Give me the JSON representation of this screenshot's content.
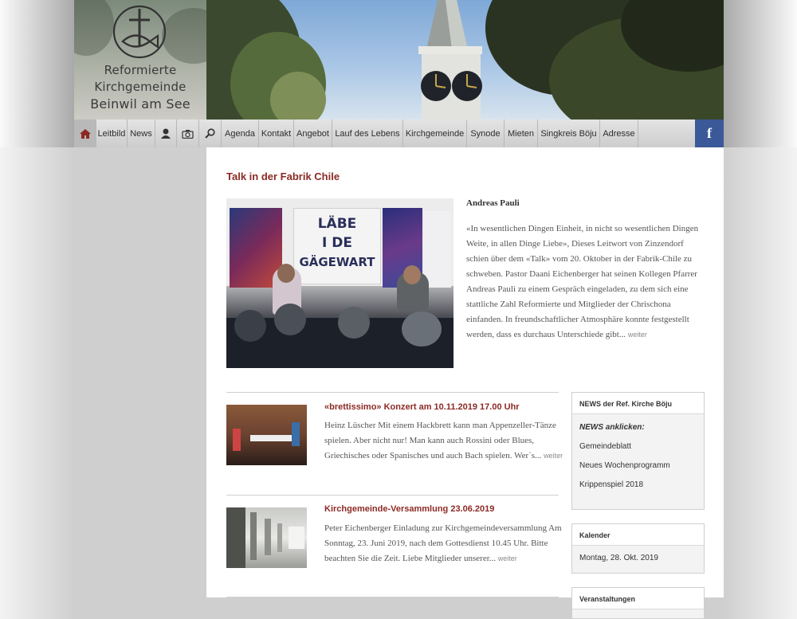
{
  "logo": {
    "lines": [
      "Reformierte",
      "Kirchgemeinde",
      "Beinwil am See"
    ]
  },
  "nav": {
    "home_icon": "home-icon",
    "items": [
      "Leitbild",
      "News",
      "Agenda",
      "Kontakt",
      "Angebot",
      "Lauf des Lebens",
      "Kirchgemeinde",
      "Synode",
      "Mieten",
      "Singkreis Böju",
      "Adresse"
    ],
    "person_icon": "person-icon",
    "camera_icon": "camera-icon",
    "search_icon": "search-icon",
    "facebook_label": "f"
  },
  "featured": {
    "title": "Talk in der Fabrik Chile",
    "image_text": [
      "LÄBE",
      "I DE",
      "GÄGEWART"
    ],
    "author": "Andreas Pauli",
    "text": "«In wesentlichen Dingen Einheit, in nicht so wesentlichen Dingen Weite, in allen Dinge Liebe», Dieses Leitwort von Zinzendorf schien über dem «Talk» vom 20. Oktober in der Fabrik-Chile zu schweben. Pastor Daani Eichenberger hat seinen Kollegen Pfarrer Andreas Pauli zu einem Gespräch eingeladen, zu dem sich eine stattliche Zahl Reformierte und Mitglieder der Chrischona einfanden. In freundschaftlicher Atmosphäre konnte festgestellt werden, dass es durchaus Unterschiede gibt...",
    "more": "weiter"
  },
  "articles": [
    {
      "title": "«brettissimo» Konzert am 10.11.2019 17.00 Uhr",
      "text": "Heinz Lüscher Mit einem Hackbrett kann man Appenzeller-Tänze spielen. Aber nicht nur! Man kann auch Rossini oder Blues, Griechisches oder Spanisches und auch Bach spielen. Wer`s...",
      "more": "weiter"
    },
    {
      "title": "Kirchgemeinde-Versammlung 23.06.2019",
      "text": "Peter Eichenberger Einladung zur Kirchgemeindeversammlung Am Sonntag, 23. Juni 2019, nach dem Gottesdienst 10.45 Uhr. Bitte beachten Sie die Zeit. Liebe Mitglieder unserer...",
      "more": "weiter"
    }
  ],
  "sidebar": {
    "news": {
      "header": "NEWS der Ref. Kirche Böju",
      "intro": "NEWS anklicken:",
      "links": [
        "Gemeindeblatt",
        "Neues Wochenprogramm",
        "Krippenspiel 2018"
      ]
    },
    "calendar": {
      "header": "Kalender",
      "date": "Montag, 28. Okt. 2019"
    },
    "events": {
      "header": "Veranstaltungen"
    }
  },
  "colors": {
    "accent": "#8c2a24",
    "facebook": "#3b5998",
    "nav_bg": "#d8d8d8"
  }
}
